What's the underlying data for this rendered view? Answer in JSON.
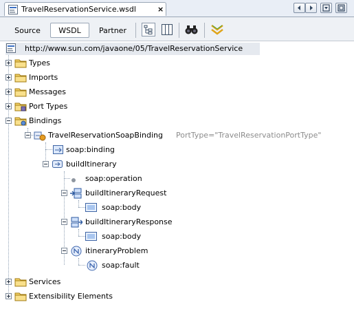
{
  "document_tab": {
    "title": "TravelReservationService.wsdl",
    "close": "×",
    "icon": "wsdl-file-icon"
  },
  "tab_controls": [
    "scroll-left-icon",
    "scroll-right-icon",
    "document-list-icon",
    "maximize-icon"
  ],
  "view_tabs": [
    {
      "label": "Source",
      "active": false
    },
    {
      "label": "WSDL",
      "active": true
    },
    {
      "label": "Partner",
      "active": false
    }
  ],
  "toolbar_tools": [
    "tree-view-icon",
    "column-view-icon",
    "find-binoculars-icon",
    "validate-icon"
  ],
  "tree": {
    "root": {
      "label": "http://www.sun.com/javaone/05/TravelReservationService",
      "icon": "wsdl-file-icon"
    },
    "types": {
      "label": "Types"
    },
    "imports": {
      "label": "Imports"
    },
    "messages": {
      "label": "Messages"
    },
    "port_types": {
      "label": "Port Types"
    },
    "bindings": {
      "label": "Bindings"
    },
    "binding": {
      "label": "TravelReservationSoapBinding",
      "attr": "PortType=\"TravelReservationPortType\""
    },
    "soap_binding": {
      "label": "soap:binding"
    },
    "operation": {
      "label": "buildItinerary"
    },
    "soap_operation": {
      "label": "soap:operation"
    },
    "request": {
      "label": "buildItineraryRequest"
    },
    "request_body": {
      "label": "soap:body"
    },
    "response": {
      "label": "buildItineraryResponse"
    },
    "response_body": {
      "label": "soap:body"
    },
    "fault": {
      "label": "itineraryProblem"
    },
    "soap_fault": {
      "label": "soap:fault"
    },
    "services": {
      "label": "Services"
    },
    "extensibility": {
      "label": "Extensibility Elements"
    }
  },
  "colors": {
    "folder": "#f0c040",
    "selection": "#e5e9ef",
    "attribute_text": "#8c8c8c",
    "link_blue": "#3a6fc4"
  }
}
